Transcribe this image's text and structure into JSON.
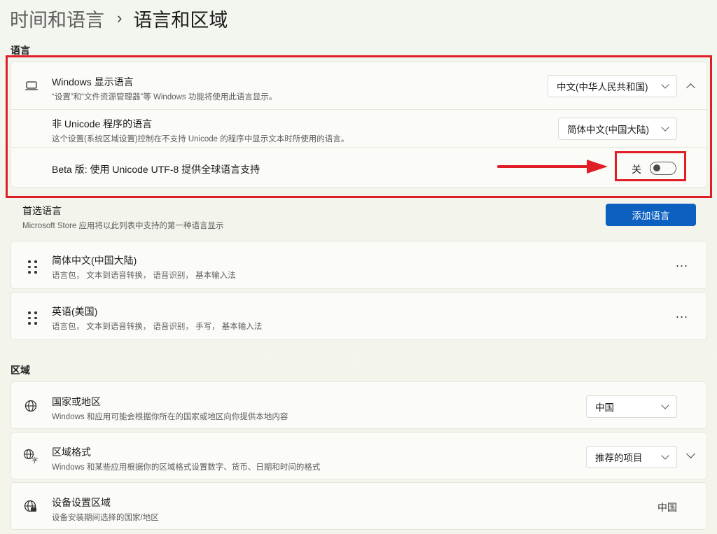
{
  "breadcrumb": {
    "parent": "时间和语言",
    "separator": "›",
    "current": "语言和区域"
  },
  "language_section": {
    "title": "语言",
    "display_language": {
      "title": "Windows 显示语言",
      "subtitle": "“设置”和“文件资源管理器”等 Windows 功能将使用此语言显示。",
      "selected": "中文(中华人民共和国)"
    },
    "non_unicode": {
      "title": "非 Unicode 程序的语言",
      "subtitle": "这个设置(系统区域设置)控制在不支持 Unicode 的程序中显示文本时所使用的语言。",
      "selected": "简体中文(中国大陆)"
    },
    "beta_utf8": {
      "title": "Beta 版: 使用 Unicode UTF-8 提供全球语言支持",
      "state_label": "关",
      "on": false
    },
    "preferred": {
      "title": "首选语言",
      "subtitle": "Microsoft Store 应用将以此列表中支持的第一种语言显示",
      "add_button": "添加语言"
    },
    "languages": [
      {
        "name": "简体中文(中国大陆)",
        "features": "语言包， 文本到语音转换， 语音识别， 基本输入法",
        "more": "..."
      },
      {
        "name": "英语(美国)",
        "features": "语言包， 文本到语音转换， 语音识别， 手写， 基本输入法",
        "more": "..."
      }
    ]
  },
  "region_section": {
    "title": "区域",
    "country": {
      "title": "国家或地区",
      "subtitle": "Windows 和应用可能会根据你所在的国家或地区向你提供本地内容",
      "selected": "中国"
    },
    "format": {
      "title": "区域格式",
      "subtitle": "Windows 和某些应用根据你的区域格式设置数字、货币、日期和时间的格式",
      "selected": "推荐的项目"
    },
    "device_region": {
      "title": "设备设置区域",
      "subtitle": "设备安装期间选择的国家/地区",
      "value": "中国"
    }
  },
  "colors": {
    "accent": "#0c60c0",
    "annotation_red": "#e01e25"
  }
}
